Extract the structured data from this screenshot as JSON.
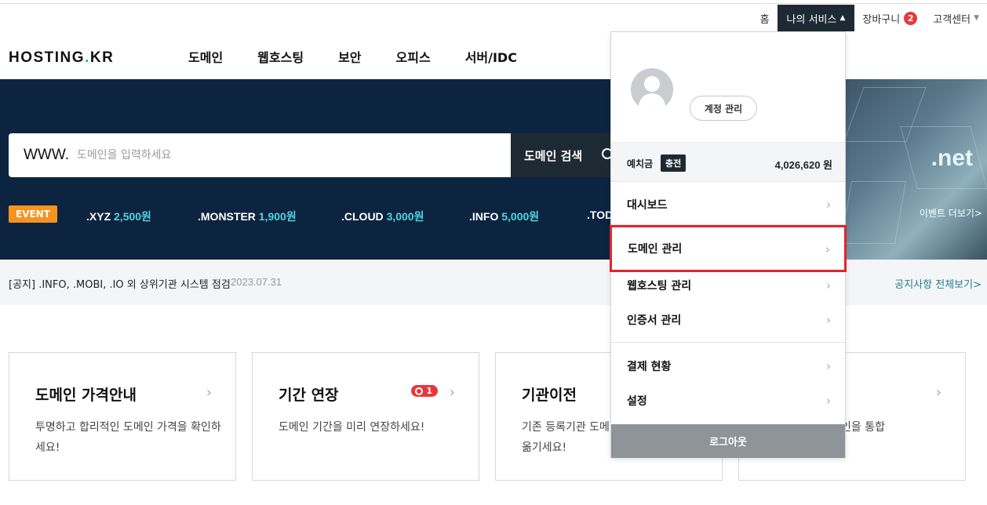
{
  "util": {
    "home": "홈",
    "my_services": "나의 서비스",
    "cart": "장바구니",
    "cart_count": "2",
    "support": "고객센터"
  },
  "logo": {
    "part1": "HOSTING",
    "dot": ".",
    "part2": "KR"
  },
  "gnb": [
    "도메인",
    "웹호스팅",
    "보안",
    "오피스",
    "서버/IDC"
  ],
  "search": {
    "prefix": "WWW.",
    "placeholder": "도메인을 입력하세요",
    "button": "도메인 검색"
  },
  "event": {
    "badge": "EVENT",
    "items": [
      {
        "tld": ".XYZ",
        "price": "2,500원"
      },
      {
        "tld": ".MONSTER",
        "price": "1,900원"
      },
      {
        "tld": ".CLOUD",
        "price": "3,000원"
      },
      {
        "tld": ".INFO",
        "price": "5,000원"
      },
      {
        "tld": ".TOD",
        "price": ""
      }
    ],
    "banner_text": ".net",
    "more": "이벤트 더보기>"
  },
  "notice": {
    "text": "[공지] .INFO, .MOBI, .IO 외 상위기관 시스템 점검",
    "date": "2023.07.31",
    "all": "공지사항 전체보기>"
  },
  "cards": [
    {
      "title": "도메인 가격안내",
      "desc": "투명하고 합리적인 도메인 가격을 확인하세요!"
    },
    {
      "title": "기간 연장",
      "desc": "도메인 기간을 미리 연장하세요!",
      "badge": "1"
    },
    {
      "title": "기관이전",
      "desc": "기존 등록기관 도메\n옮기세요!"
    },
    {
      "title": "",
      "desc": "인을 통합"
    }
  ],
  "dropdown": {
    "account": "계정 관리",
    "deposit_label": "예치금",
    "charge": "충전",
    "deposit_amount": "4,026,620 원",
    "items": [
      "대시보드",
      "도메인 관리",
      "웹호스팅 관리",
      "인증서 관리",
      "결제 현황",
      "설정"
    ],
    "logout": "로그아웃"
  }
}
